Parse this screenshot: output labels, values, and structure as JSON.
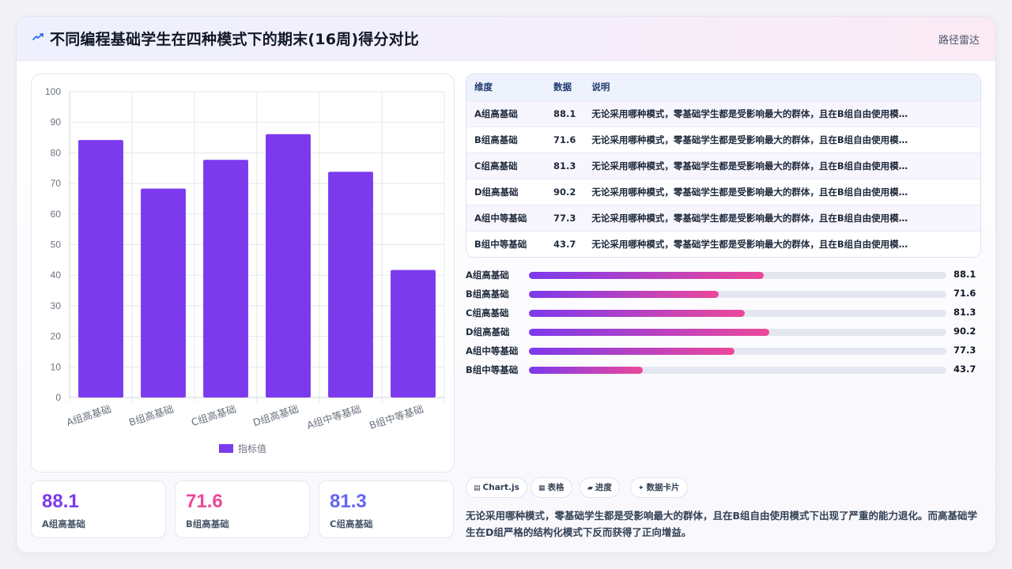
{
  "header": {
    "title": "不同编程基础学生在四种模式下的期末(16周)得分对比",
    "tag": "路径雷达"
  },
  "colors": {
    "bar": "#7c3aed",
    "gradient_start": "#7c3aed",
    "gradient_end": "#ec4899",
    "kpi_1": "#7c3aed",
    "kpi_2": "#ec4899",
    "kpi_3": "#6366f1"
  },
  "chart_data": {
    "type": "bar",
    "categories": [
      "A组高基础",
      "B组高基础",
      "C组高基础",
      "D组高基础",
      "A组中等基础",
      "B组中等基础"
    ],
    "series": [
      {
        "name": "指标值",
        "values": [
          84.2,
          68.3,
          77.7,
          86.1,
          73.8,
          41.7
        ]
      }
    ],
    "ylim": [
      0,
      100
    ],
    "yticks": [
      0,
      10,
      20,
      30,
      40,
      50,
      60,
      70,
      80,
      90,
      100
    ],
    "grid": true,
    "legend": "bottom"
  },
  "table": {
    "headers": [
      "维度",
      "数据",
      "说明"
    ],
    "rows": [
      {
        "dim": "A组高基础",
        "val": "88.1",
        "note": "无论采用哪种模式，零基础学生都是受影响最大的群体，且在B组自由使用模…"
      },
      {
        "dim": "B组高基础",
        "val": "71.6",
        "note": "无论采用哪种模式，零基础学生都是受影响最大的群体，且在B组自由使用模…"
      },
      {
        "dim": "C组高基础",
        "val": "81.3",
        "note": "无论采用哪种模式，零基础学生都是受影响最大的群体，且在B组自由使用模…"
      },
      {
        "dim": "D组高基础",
        "val": "90.2",
        "note": "无论采用哪种模式，零基础学生都是受影响最大的群体，且在B组自由使用模…"
      },
      {
        "dim": "A组中等基础",
        "val": "77.3",
        "note": "无论采用哪种模式，零基础学生都是受影响最大的群体，且在B组自由使用模…"
      },
      {
        "dim": "B组中等基础",
        "val": "43.7",
        "note": "无论采用哪种模式，零基础学生都是受影响最大的群体，且在B组自由使用模…"
      }
    ]
  },
  "progress": [
    {
      "label": "A组高基础",
      "value": "88.1",
      "fill_percent": 56.2
    },
    {
      "label": "B组高基础",
      "value": "71.6",
      "fill_percent": 45.5
    },
    {
      "label": "C组高基础",
      "value": "81.3",
      "fill_percent": 51.7
    },
    {
      "label": "D组高基础",
      "value": "90.2",
      "fill_percent": 57.5
    },
    {
      "label": "A组中等基础",
      "value": "77.3",
      "fill_percent": 49.2
    },
    {
      "label": "B组中等基础",
      "value": "43.7",
      "fill_percent": 27.3
    }
  ],
  "kpis": [
    {
      "value": "88.1",
      "label": "A组高基础"
    },
    {
      "value": "71.6",
      "label": "B组高基础"
    },
    {
      "value": "81.3",
      "label": "C组高基础"
    }
  ],
  "chips": [
    {
      "icon": "▤",
      "label": "Chart.js",
      "icon_name": "chart-icon"
    },
    {
      "icon": "▦",
      "label": "表格",
      "icon_name": "table-icon"
    },
    {
      "icon": "▰",
      "label": "进度",
      "icon_name": "progress-icon"
    },
    {
      "icon": "✦",
      "label": "数据卡片",
      "icon_name": "sparkle-icon"
    }
  ],
  "description": "无论采用哪种模式，零基础学生都是受影响最大的群体，且在B组自由使用模式下出现了严重的能力退化。而高基础学生在D组严格的结构化模式下反而获得了正向增益。"
}
